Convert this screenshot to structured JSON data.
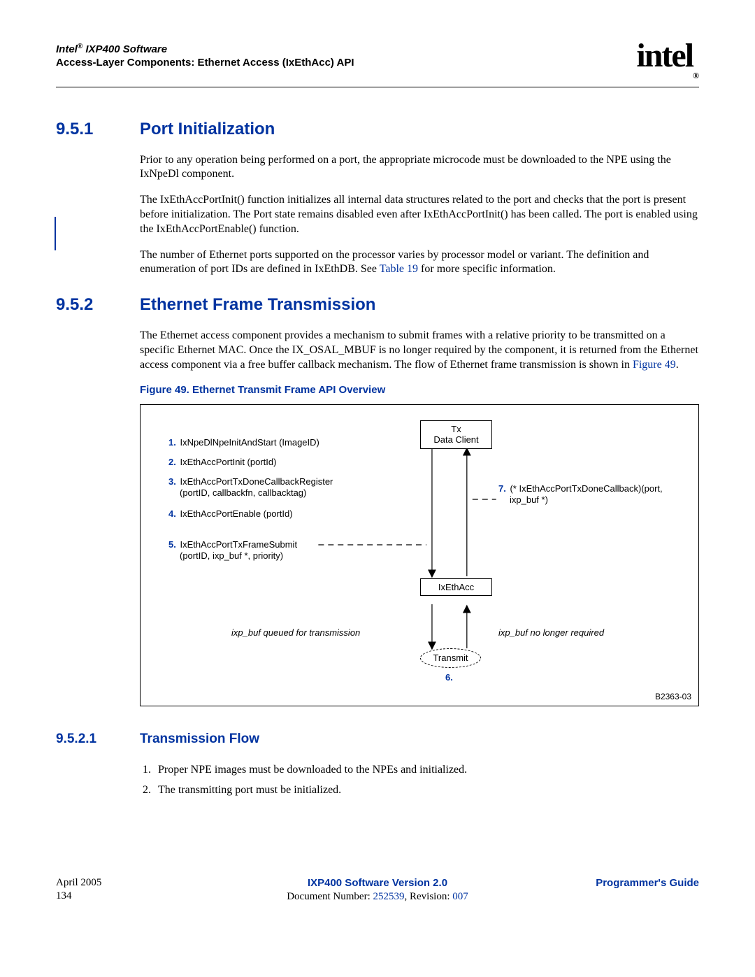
{
  "header": {
    "product_line": "Intel",
    "reg": "®",
    "product_name": " IXP400 Software",
    "subtitle": "Access-Layer Components: Ethernet Access (IxEthAcc) API",
    "logo_text": "intel",
    "logo_reg": "®"
  },
  "section1": {
    "num": "9.5.1",
    "title": "Port Initialization",
    "p1": "Prior to any operation being performed on a port, the appropriate microcode must be downloaded to the NPE using the IxNpeDl component.",
    "p2": "The IxEthAccPortInit() function initializes all internal data structures related to the port and checks that the port is present before initialization. The Port state remains disabled even after IxEthAccPortInit() has been called. The port is enabled using the IxEthAccPortEnable() function.",
    "p3a": "The number of Ethernet ports supported on the processor varies by processor model or variant. The definition and enumeration of port IDs are defined in IxEthDB. See ",
    "p3_link": "Table 19",
    "p3b": " for more specific information."
  },
  "section2": {
    "num": "9.5.2",
    "title": "Ethernet Frame Transmission",
    "p1a": "The Ethernet access component provides a mechanism to submit frames with a relative priority to be transmitted on a specific Ethernet MAC. Once the IX_OSAL_MBUF is no longer required by the component, it is returned from the Ethernet access component via a free buffer callback mechanism. The flow of Ethernet frame transmission is shown in ",
    "p1_link": "Figure 49",
    "p1b": "."
  },
  "figure": {
    "caption": "Figure 49. Ethernet Transmit Frame API Overview",
    "tx_client": "Tx\nData Client",
    "ixethacc": "IxEthAcc",
    "transmit": "Transmit",
    "steps": {
      "n1": "1.",
      "s1": " IxNpeDlNpeInitAndStart (ImageID)",
      "n2": "2.",
      "s2": " IxEthAccPortInit (portId)",
      "n3": "3.",
      "s3a": " IxEthAccPortTxDoneCallbackRegister",
      "s3b": "(portID, callbackfn, callbacktag)",
      "n4": "4.",
      "s4": " IxEthAccPortEnable (portId)",
      "n5": "5.",
      "s5a": " IxEthAccPortTxFrameSubmit",
      "s5b": "(portID, ixp_buf *, priority)",
      "n7": "7.",
      "s7a": " (* IxEthAccPortTxDoneCallback)(port,",
      "s7b": "ixp_buf *)",
      "n6": "6."
    },
    "label_left": "ixp_buf queued for transmission",
    "label_right": "ixp_buf no longer required",
    "fig_id": "B2363-03"
  },
  "section3": {
    "num": "9.5.2.1",
    "title": "Transmission Flow",
    "items": [
      "Proper NPE images must be downloaded to the NPEs and initialized.",
      "The transmitting port must be initialized."
    ]
  },
  "footer": {
    "date": "April 2005",
    "page": "134",
    "center_title": "IXP400 Software Version 2.0",
    "doc_label": "Document Number: ",
    "doc_num": "252539",
    "rev_label": ", Revision: ",
    "rev_num": "007",
    "right": "Programmer's Guide"
  }
}
